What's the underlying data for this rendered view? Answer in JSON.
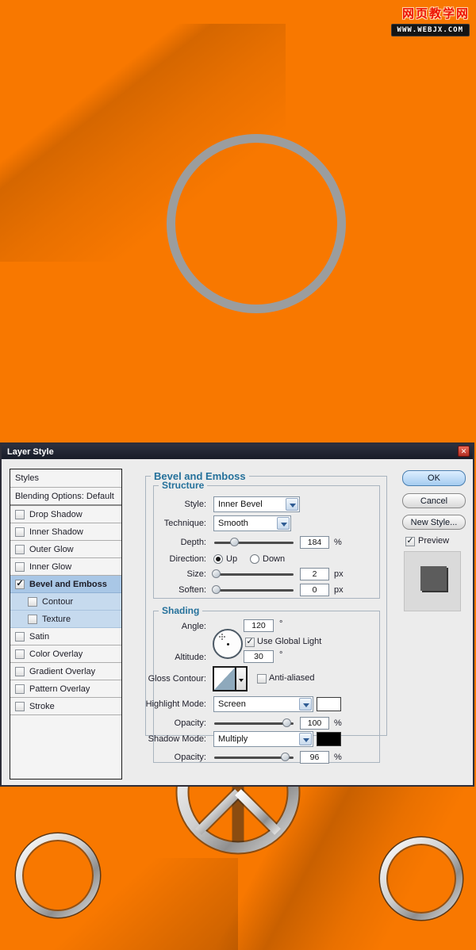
{
  "colors": {
    "canvas_orange": "#f87800",
    "ring_gray": "#9b9d9e",
    "dialog_bg": "#ececec",
    "titlebar": "#1c2230",
    "accent_blue": "#25719b",
    "selected_row": "#a9c7e6",
    "ok_button": "#a5ccf0",
    "highlight_swatch": "#ffffff",
    "shadow_swatch": "#000000"
  },
  "icons": {
    "check": "✓",
    "close": "✕"
  },
  "watermark": {
    "site_name": "网页教学网",
    "site_url": "WWW.WEBJX.COM"
  },
  "dialog": {
    "title": "Layer Style",
    "sidebar": {
      "styles": "Styles",
      "blending": "Blending Options: Default",
      "items": [
        {
          "label": "Drop Shadow",
          "check": ""
        },
        {
          "label": "Inner Shadow",
          "check": ""
        },
        {
          "label": "Outer Glow",
          "check": ""
        },
        {
          "label": "Inner Glow",
          "check": ""
        },
        {
          "label": "Bevel and Emboss",
          "check": "✓"
        },
        {
          "label": "Contour",
          "check": ""
        },
        {
          "label": "Texture",
          "check": ""
        },
        {
          "label": "Satin",
          "check": ""
        },
        {
          "label": "Color Overlay",
          "check": ""
        },
        {
          "label": "Gradient Overlay",
          "check": ""
        },
        {
          "label": "Pattern Overlay",
          "check": ""
        },
        {
          "label": "Stroke",
          "check": ""
        }
      ]
    },
    "panel_title": "Bevel and Emboss",
    "structure": {
      "legend": "Structure",
      "style_label": "Style:",
      "style_value": "Inner Bevel",
      "technique_label": "Technique:",
      "technique_value": "Smooth",
      "depth_label": "Depth:",
      "depth_value": "184",
      "depth_unit": "%",
      "direction_label": "Direction:",
      "direction_up": "Up",
      "direction_down": "Down",
      "direction_selected": "Up",
      "size_label": "Size:",
      "size_value": "2",
      "size_unit": "px",
      "soften_label": "Soften:",
      "soften_value": "0",
      "soften_unit": "px"
    },
    "shading": {
      "legend": "Shading",
      "angle_label": "Angle:",
      "angle_value": "120",
      "angle_unit": "°",
      "use_global_light_label": "Use Global Light",
      "use_global_light_check": "✓",
      "altitude_label": "Altitude:",
      "altitude_value": "30",
      "altitude_unit": "°",
      "gloss_label": "Gloss Contour:",
      "anti_aliased_label": "Anti-aliased",
      "anti_aliased_check": "",
      "highlight_label": "Highlight Mode:",
      "highlight_value": "Screen",
      "opacity_highlight_label": "Opacity:",
      "opacity_highlight_value": "100",
      "opacity_highlight_unit": "%",
      "shadow_label": "Shadow Mode:",
      "shadow_value": "Multiply",
      "opacity_shadow_label": "Opacity:",
      "opacity_shadow_value": "96",
      "opacity_shadow_unit": "%"
    },
    "buttons": {
      "ok": "OK",
      "cancel": "Cancel",
      "new_style": "New Style...",
      "preview": "Preview",
      "preview_check": "✓"
    },
    "sliders": {
      "depth": 25,
      "size": 2,
      "soften": 2,
      "opacity_highlight": 91,
      "opacity_shadow": 89
    }
  }
}
